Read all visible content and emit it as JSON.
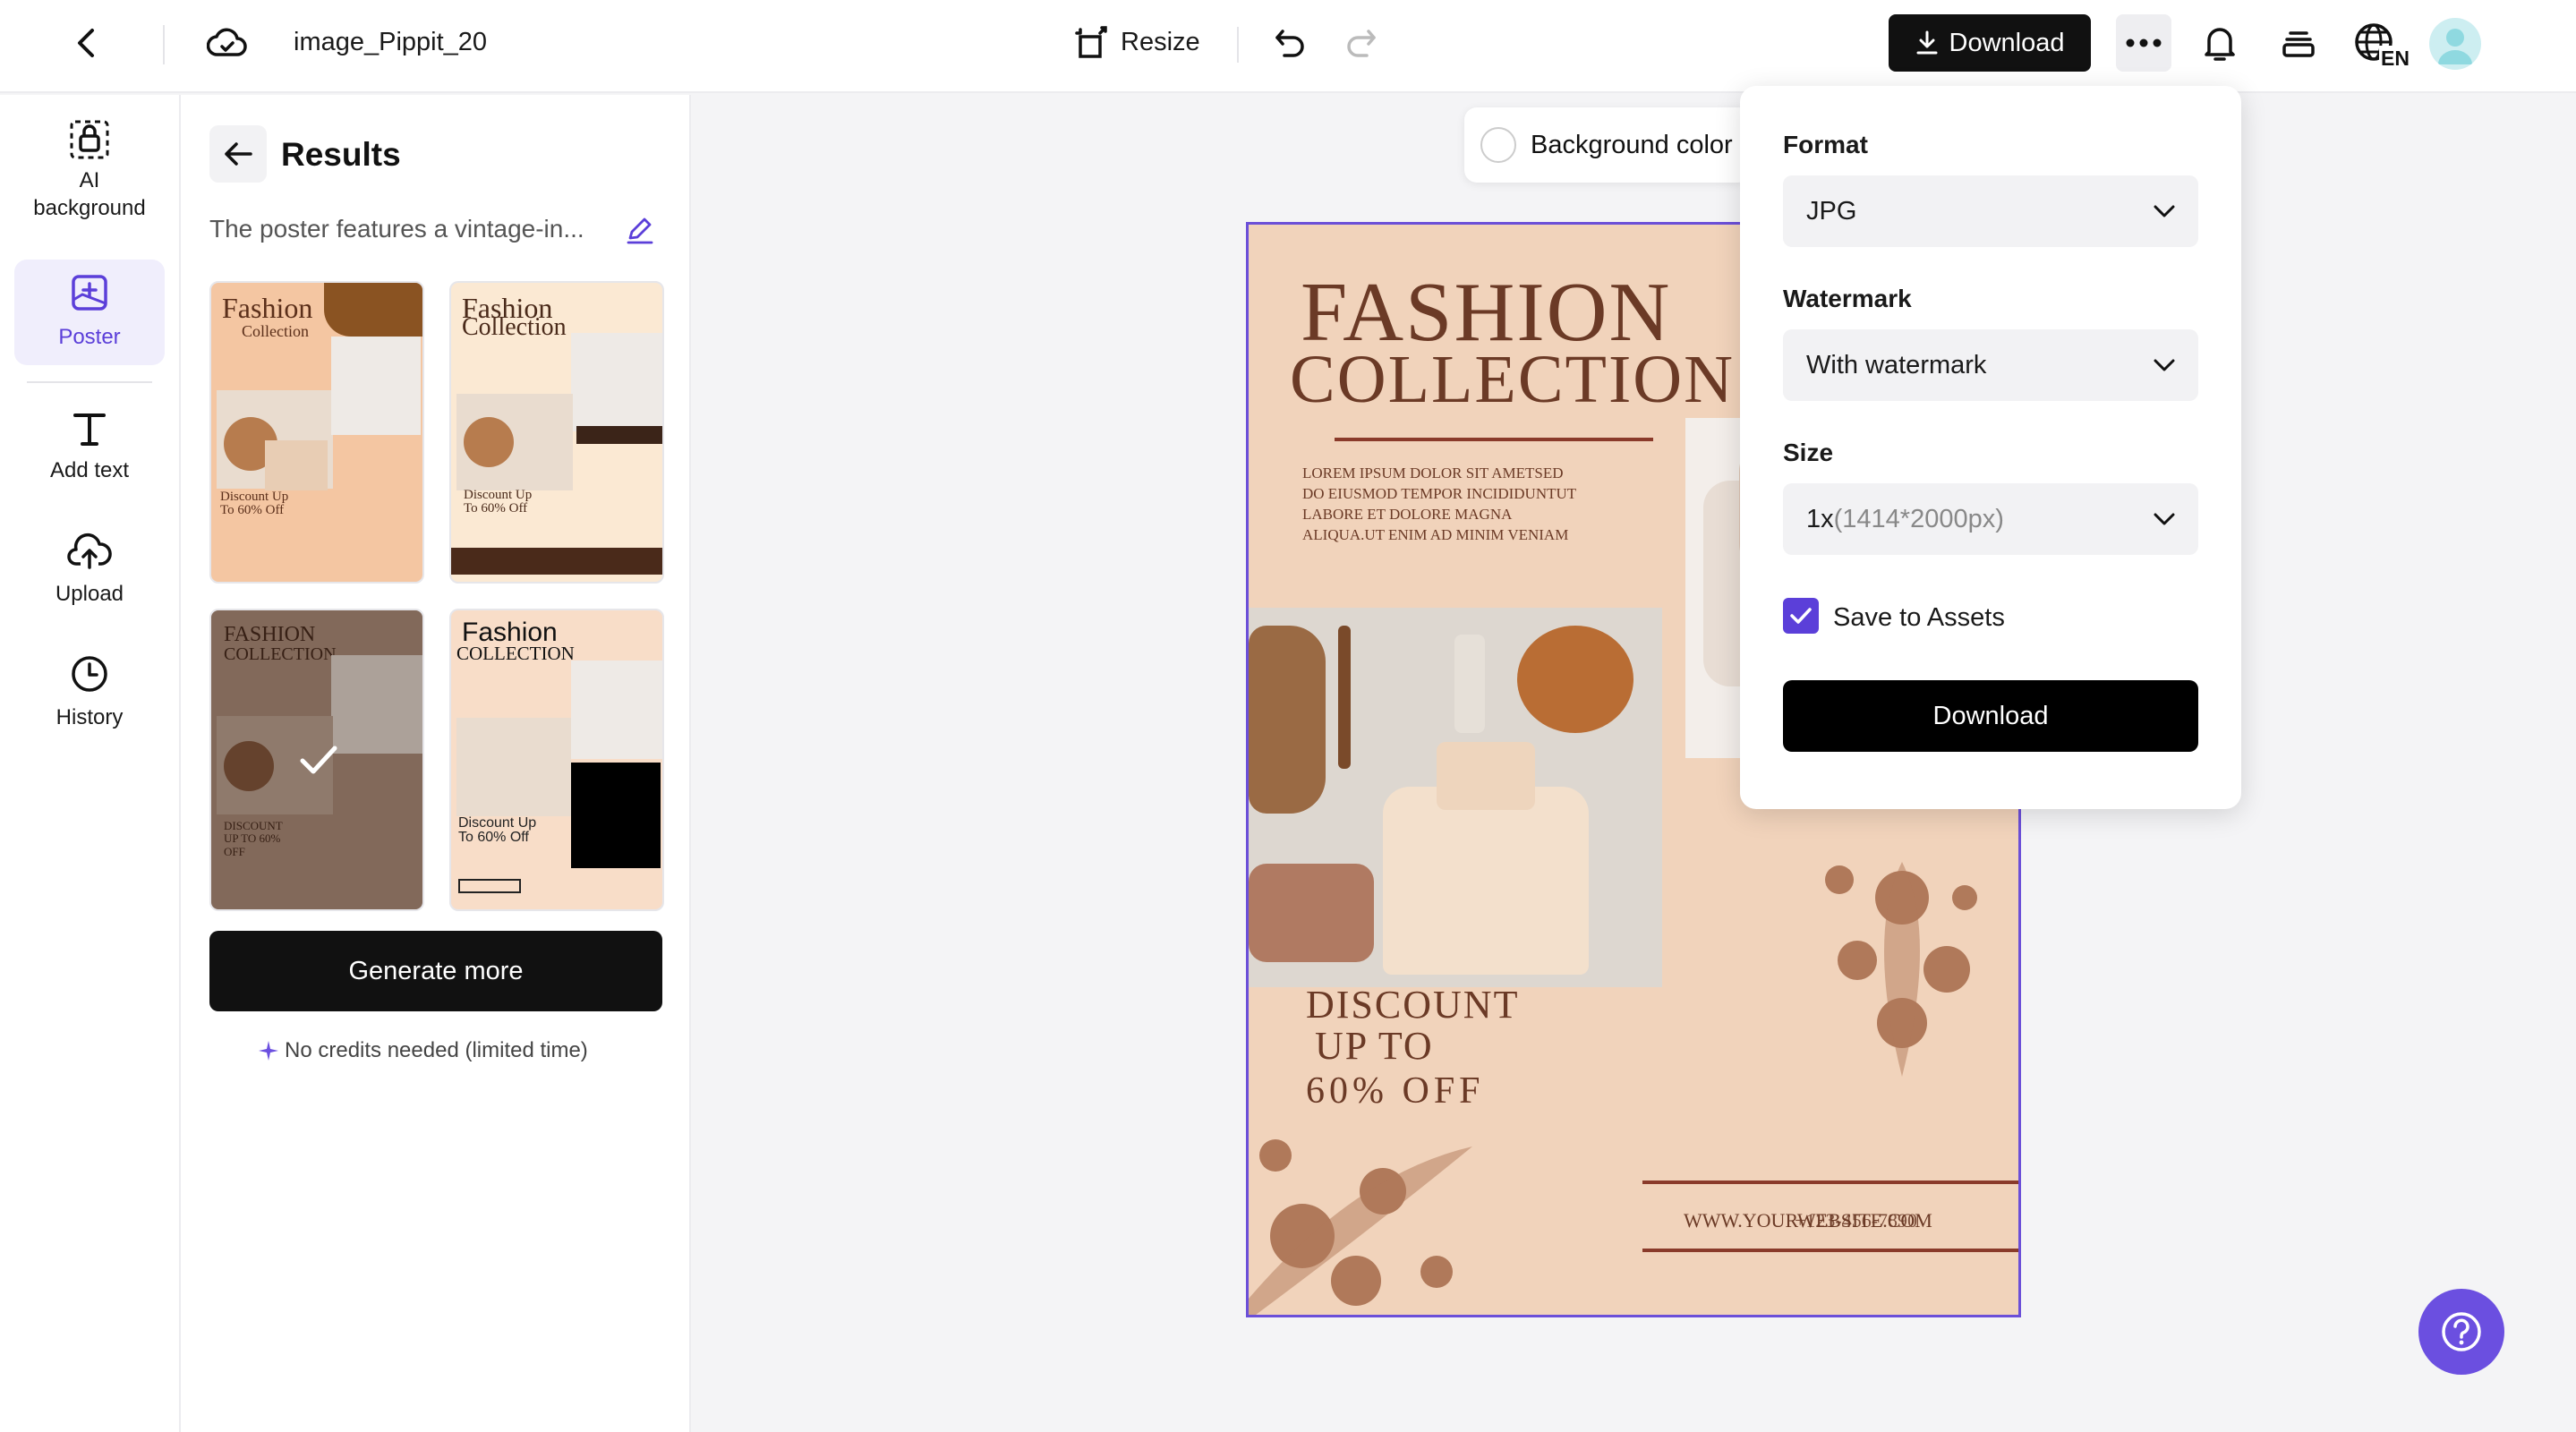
{
  "header": {
    "file_name": "image_Pippit_20",
    "resize_label": "Resize",
    "download_label": "Download",
    "lang_badge": "EN"
  },
  "rail": {
    "items": [
      {
        "label": "AI background",
        "icon": "ai-background-icon"
      },
      {
        "label": "Poster",
        "icon": "poster-icon",
        "active": true
      },
      {
        "label": "Add text",
        "icon": "text-icon"
      },
      {
        "label": "Upload",
        "icon": "upload-icon"
      },
      {
        "label": "History",
        "icon": "history-icon"
      }
    ]
  },
  "panel": {
    "title": "Results",
    "prompt": "The poster features a vintage-in...",
    "generate_label": "Generate more",
    "credits_note": "No credits needed (limited time)",
    "thumbnails": [
      {
        "title": "Fashion",
        "subtitle": "Collection",
        "discount": "Discount Up To 60% Off"
      },
      {
        "title": "Fashion",
        "subtitle": "Collection",
        "discount": "Discount Up To 60% Off"
      },
      {
        "title": "FASHION",
        "subtitle": "COLLECTION",
        "discount": "DISCOUNT UP TO 60% OFF",
        "selected": true
      },
      {
        "title": "Fashion",
        "subtitle": "COLLECTION",
        "discount": "Discount Up To 60% Off"
      }
    ]
  },
  "canvas": {
    "bg_color_label": "Background color",
    "poster": {
      "title_line1": "FASHION",
      "title_line2": "COLLECTION",
      "body": "LOREM IPSUM DOLOR SIT AMETSED DO EIUSMOD TEMPOR INCIDIDUNTUT LABORE ET DOLORE MAGNA ALIQUA.UT ENIM AD MINIM VENIAM",
      "discount_line1": "DISCOUNT",
      "discount_line2": "UP TO",
      "discount_line3": "60% OFF",
      "website": "WWW.YOURWEBSITE.COM",
      "phone": "+123-456-7890"
    }
  },
  "download_menu": {
    "format_label": "Format",
    "format_value": "JPG",
    "watermark_label": "Watermark",
    "watermark_value": "With watermark",
    "size_label": "Size",
    "size_value": "1x",
    "size_detail": "(1414*2000px)",
    "save_assets_label": "Save to Assets",
    "save_assets_checked": true,
    "download_label": "Download"
  },
  "colors": {
    "accent": "#5b3fd9",
    "poster_bg": "#f1d3bb",
    "poster_text": "#6b3a26"
  }
}
